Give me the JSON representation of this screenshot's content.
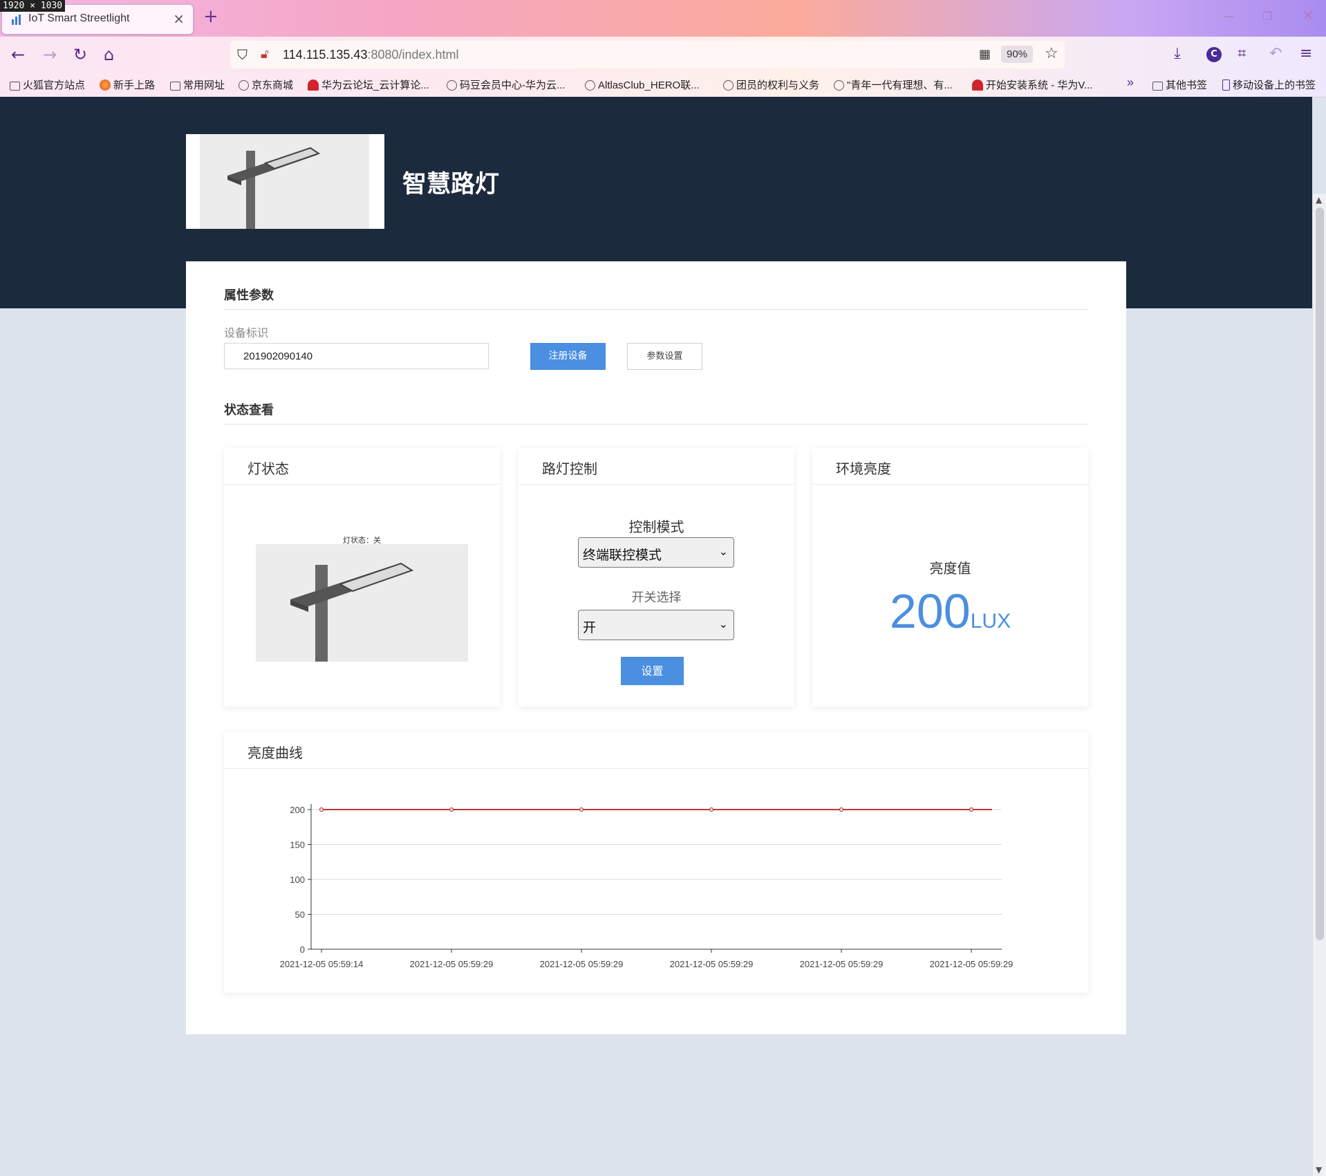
{
  "screen_badge": "1920 × 1030",
  "browser": {
    "tab_title": "IoT Smart Streetlight",
    "url_host": "114.115.135.43",
    "url_rest": ":8080/index.html",
    "zoom": "90%",
    "bookmarks": [
      {
        "label": "火狐官方站点",
        "icon": "folder-icon"
      },
      {
        "label": "新手上路",
        "icon": "firefox-icon"
      },
      {
        "label": "常用网址",
        "icon": "folder-icon"
      },
      {
        "label": "京东商城",
        "icon": "globe-icon"
      },
      {
        "label": "华为云论坛_云计算论...",
        "icon": "huawei-icon"
      },
      {
        "label": "码豆会员中心-华为云...",
        "icon": "globe-icon"
      },
      {
        "label": "AltlasClub_HERO联...",
        "icon": "globe-icon"
      },
      {
        "label": "团员的权利与义务",
        "icon": "globe-icon"
      },
      {
        "label": "\"青年一代有理想、有...",
        "icon": "globe-icon"
      },
      {
        "label": "开始安装系统 - 华为V...",
        "icon": "huawei-icon"
      }
    ],
    "other_bookmarks": "其他书签",
    "mobile_bookmarks": "移动设备上的书签"
  },
  "header": {
    "title": "智慧路灯"
  },
  "properties": {
    "section_title": "属性参数",
    "device_label": "设备标识",
    "device_id": "201902090140",
    "register_button": "注册设备",
    "settings_button": "参数设置"
  },
  "status": {
    "section_title": "状态查看",
    "lamp_panel": {
      "title": "灯状态",
      "caption": "灯状态：关"
    },
    "control_panel": {
      "title": "路灯控制",
      "mode_label": "控制模式",
      "mode_value": "终端联控模式",
      "switch_label": "开关选择",
      "switch_value": "开",
      "set_button": "设置"
    },
    "brightness_panel": {
      "title": "环境亮度",
      "label": "亮度值",
      "value": "200",
      "unit": "LUX"
    }
  },
  "chart_panel": {
    "title": "亮度曲线"
  },
  "chart_data": {
    "type": "line",
    "title": "",
    "xlabel": "",
    "ylabel": "",
    "categories": [
      "2021-12-05 05:59:14",
      "2021-12-05 05:59:29",
      "2021-12-05 05:59:29",
      "2021-12-05 05:59:29",
      "2021-12-05 05:59:29",
      "2021-12-05 05:59:29"
    ],
    "values": [
      200,
      200,
      200,
      200,
      200,
      200
    ],
    "ylim": [
      0,
      200
    ],
    "yticks": [
      0,
      50,
      100,
      150,
      200
    ],
    "grid": true,
    "color": "#c23531"
  },
  "colors": {
    "hero_bg": "#1c2a3e",
    "accent": "#4a8fe0",
    "page_bg": "#dde3ec"
  }
}
